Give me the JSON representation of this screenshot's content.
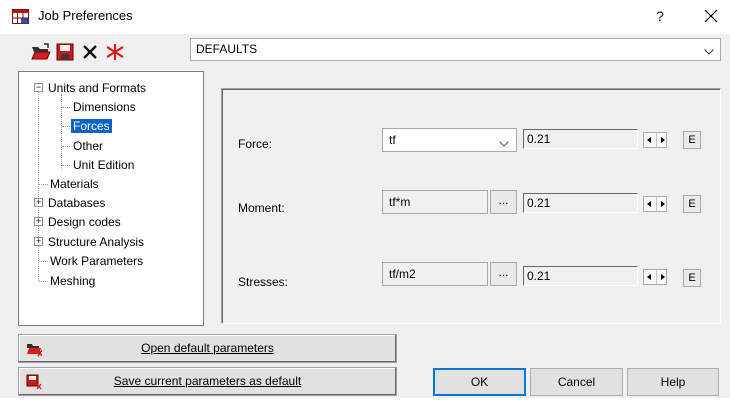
{
  "window": {
    "title": "Job Preferences",
    "help_glyph": "?",
    "close_glyph": "✕",
    "icon": "job-preferences-app-icon"
  },
  "toolbar": {
    "icons": [
      "open-folder-icon",
      "save-disk-icon",
      "delete-x-icon",
      "reset-star-icon"
    ]
  },
  "preset": {
    "value": "DEFAULTS",
    "icon": "chevron-down-icon"
  },
  "tree": {
    "items": [
      {
        "label": "Units and Formats",
        "expander": "−",
        "selected": false
      },
      {
        "label": "Dimensions",
        "selected": false
      },
      {
        "label": "Forces",
        "selected": true
      },
      {
        "label": "Other",
        "selected": false
      },
      {
        "label": "Unit Edition",
        "selected": false
      },
      {
        "label": "Materials",
        "selected": false
      },
      {
        "label": "Databases",
        "expander": "+",
        "selected": false
      },
      {
        "label": "Design codes",
        "expander": "+",
        "selected": false
      },
      {
        "label": "Structure Analysis",
        "expander": "+",
        "selected": false
      },
      {
        "label": "Work Parameters",
        "selected": false
      },
      {
        "label": "Meshing",
        "selected": false
      }
    ],
    "selection_color": "#0a64c8"
  },
  "fields": {
    "force": {
      "label": "Force:",
      "unit": "tf",
      "value": "0.21",
      "e_label": "E"
    },
    "moment": {
      "label": "Moment:",
      "unit": "tf*m",
      "more": "...",
      "value": "0.21",
      "e_label": "E"
    },
    "stresses": {
      "label": "Stresses:",
      "unit": "tf/m2",
      "more": "...",
      "value": "0.21",
      "e_label": "E"
    }
  },
  "buttons": {
    "open_default": "Open default parameters",
    "save_default": "Save current parameters as default",
    "ok": "OK",
    "cancel": "Cancel",
    "help": "Help"
  },
  "colors": {
    "dialog_bg": "#f0f0f0",
    "default_button_border": "#0078d7",
    "icon_red": "#d40000"
  }
}
